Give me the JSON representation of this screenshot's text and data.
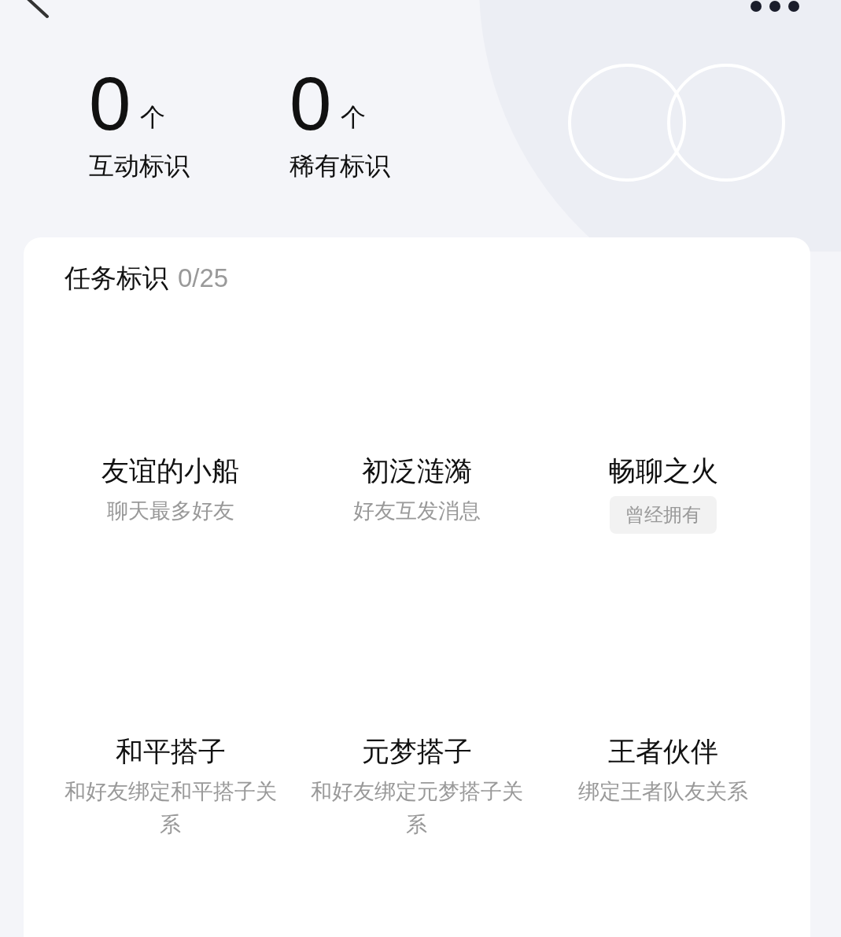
{
  "stats": [
    {
      "value": "0",
      "unit": "个",
      "label": "互动标识"
    },
    {
      "value": "0",
      "unit": "个",
      "label": "稀有标识"
    }
  ],
  "card": {
    "title": "任务标识",
    "count": "0/25",
    "items": [
      {
        "kind": "subtitle",
        "name": "友谊的小船",
        "desc": "聊天最多好友"
      },
      {
        "kind": "subtitle",
        "name": "初泛涟漪",
        "desc": "好友互发消息"
      },
      {
        "kind": "badge",
        "name": "畅聊之火",
        "desc": "曾经拥有"
      },
      {
        "kind": "subtitle",
        "name": "和平搭子",
        "desc": "和好友绑定和平搭子关系"
      },
      {
        "kind": "subtitle",
        "name": "元梦搭子",
        "desc": "和好友绑定元梦搭子关系"
      },
      {
        "kind": "subtitle",
        "name": "王者伙伴",
        "desc": "绑定王者队友关系"
      }
    ]
  }
}
